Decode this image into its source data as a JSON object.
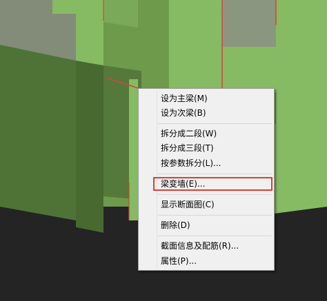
{
  "context_menu": {
    "items": [
      {
        "label": "设为主梁(M)"
      },
      {
        "label": "设为次梁(B)"
      },
      {
        "label": "拆分成二段(W)"
      },
      {
        "label": "拆分成三段(T)"
      },
      {
        "label": "按参数拆分(L)..."
      },
      {
        "label": "梁变墙(E)...",
        "highlighted": true
      },
      {
        "label": "显示断面图(C)"
      },
      {
        "label": "删除(D)"
      },
      {
        "label": "截面信息及配筋(R)..."
      },
      {
        "label": "属性(P)..."
      }
    ]
  },
  "colors": {
    "wall_front": "#4f7337",
    "wall_bright": "#86bb63",
    "wall_gray": "#838c79",
    "ground": "#242424",
    "edge_red": "#d9423a",
    "highlight_border": "#e03a32"
  }
}
